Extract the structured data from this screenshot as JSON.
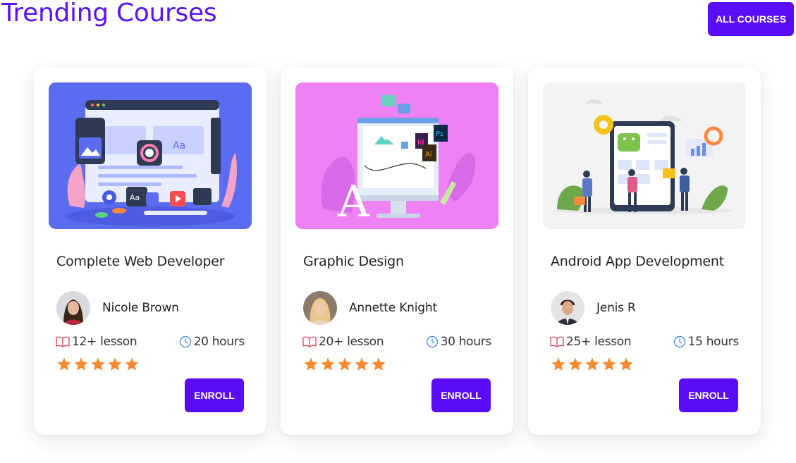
{
  "header": {
    "title": "Trending Courses",
    "all_courses_label": "ALL COURSES"
  },
  "theme": {
    "accent": "#5b0cf6",
    "title_color": "#5a13f5",
    "star_color": "#f68a33",
    "lesson_icon_color": "#e2545e",
    "clock_icon_color": "#4a8fe0"
  },
  "courses": [
    {
      "title": "Complete Web Developer",
      "thumbnail": "web-developer-illustration",
      "thumbnail_bg": "#5b6cf0",
      "instructor": "Nicole Brown",
      "lessons": "12+ lesson",
      "hours": "20 hours",
      "rating": 5,
      "enroll_label": "ENROLL"
    },
    {
      "title": "Graphic Design",
      "thumbnail": "graphic-design-illustration",
      "thumbnail_bg": "#ee82f5",
      "instructor": "Annette Knight",
      "lessons": "20+ lesson",
      "hours": "30 hours",
      "rating": 5,
      "enroll_label": "ENROLL"
    },
    {
      "title": "Android App Development",
      "thumbnail": "android-development-illustration",
      "thumbnail_bg": "#f3f3f3",
      "instructor": "Jenis R",
      "lessons": "25+ lesson",
      "hours": "15 hours",
      "rating": 5,
      "enroll_label": "ENROLL"
    }
  ]
}
